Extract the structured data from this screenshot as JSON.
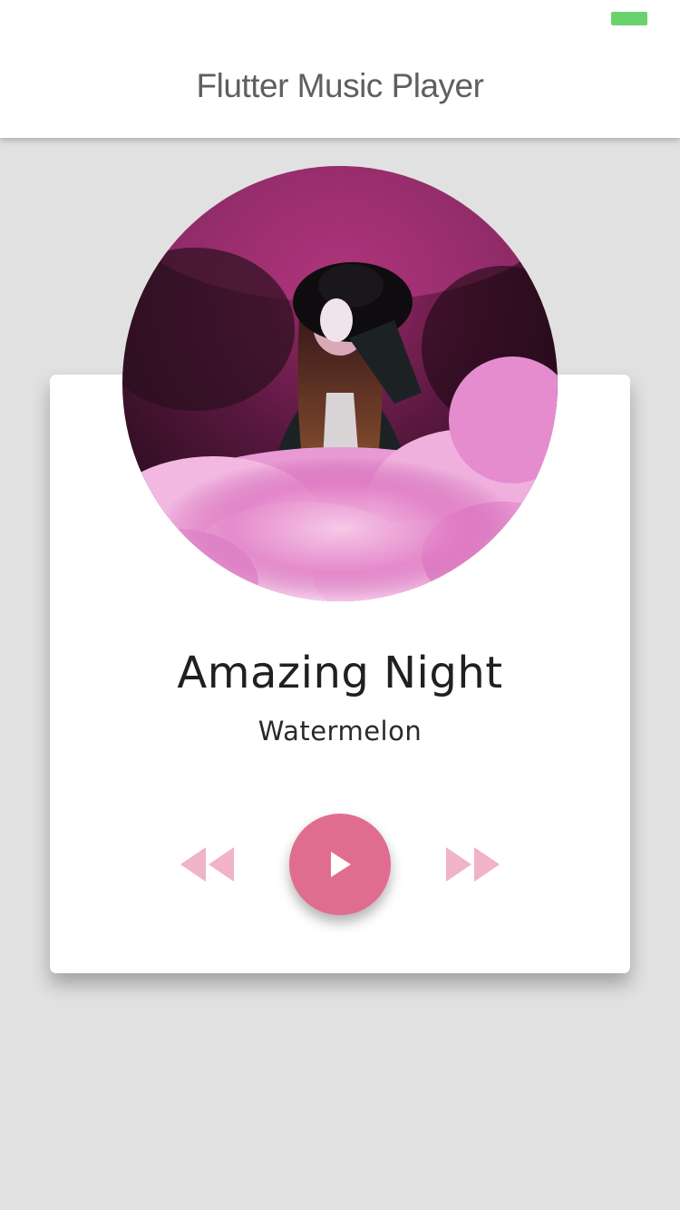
{
  "app_bar": {
    "title": "Flutter Music Player"
  },
  "status_bar": {
    "battery_color": "#6bd26b"
  },
  "now_playing": {
    "album_art_icon": "album-cover-image",
    "song_title": "Amazing Night",
    "artist": "Watermelon"
  },
  "controls": {
    "rewind_icon": "fast-rewind-icon",
    "play_icon": "play-icon",
    "forward_icon": "fast-forward-icon",
    "accent_color": "#e06d8f",
    "secondary_color": "#f0b3c8"
  }
}
